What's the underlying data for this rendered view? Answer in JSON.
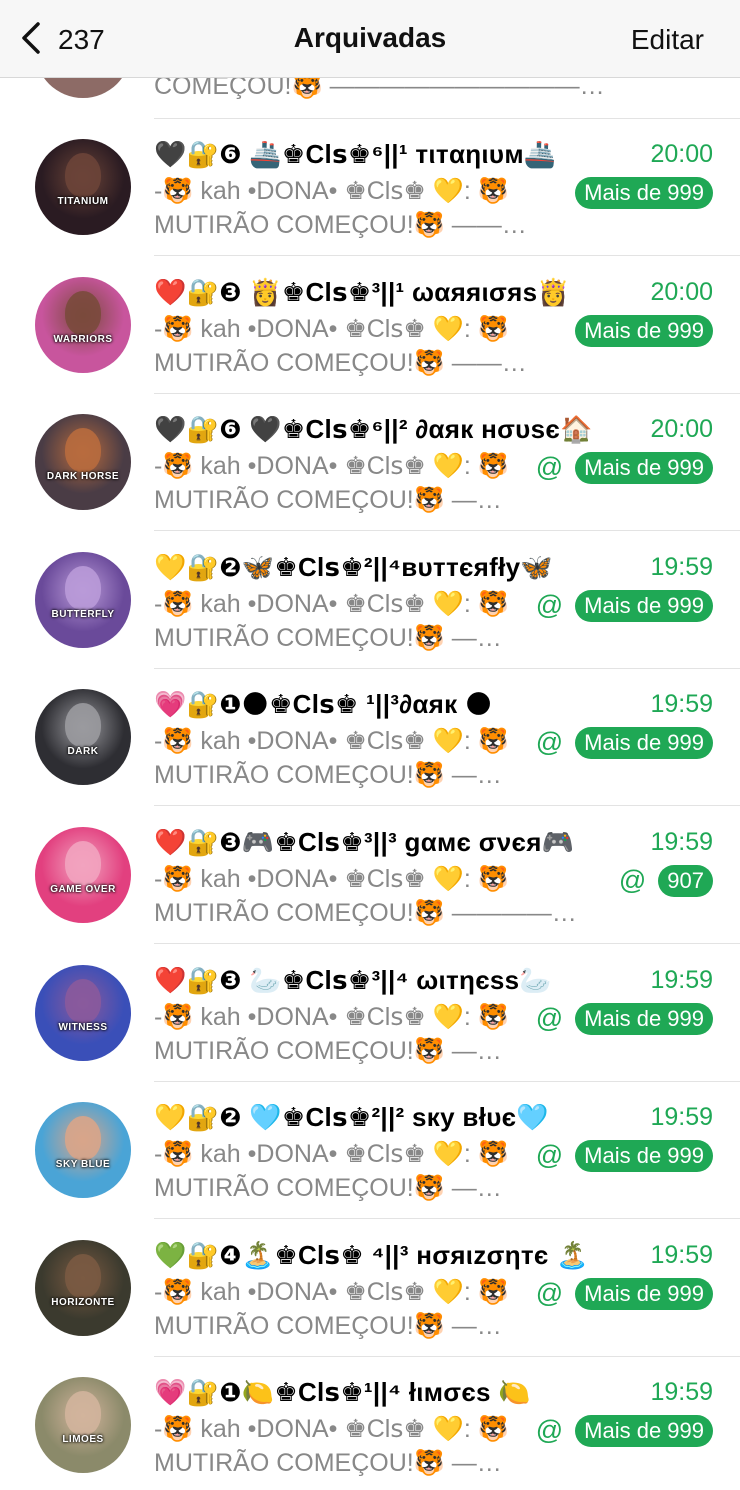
{
  "header": {
    "back_count": "237",
    "title": "Arquivadas",
    "edit_label": "Editar"
  },
  "partial_row": {
    "preview": "COMEÇOU!🐯 ——————————…"
  },
  "colors": {
    "accent_green": "#1fa855",
    "preview_gray": "#888888"
  },
  "chats": [
    {
      "name": "🖤🔐❻ 🚢♚Clꜱ♚⁶||¹ тιтαηιυм🚢",
      "time": "20:00",
      "sender": "-🐯 kah •DONA• ♚Clꜱ♚ 💛: 🐯",
      "preview": "MUTIRÃO  COMEÇOU!🐯 ——…",
      "mention": "",
      "badge": "Mais de 999",
      "avatar_label": "TITANIUM",
      "avatar_bg": "#2a1b22",
      "avatar_face": "#6b4438"
    },
    {
      "name": "❤️🔐❸ 👸♚Clꜱ♚³||¹  ωαяяισяѕ👸",
      "time": "20:00",
      "sender": "-🐯 kah •DONA• ♚Clꜱ♚ 💛: 🐯",
      "preview": "MUTIRÃO  COMEÇOU!🐯 ——…",
      "mention": "",
      "badge": "Mais de 999",
      "avatar_label": "WARRIORS",
      "avatar_bg": "#c8559d",
      "avatar_face": "#7a4a3c"
    },
    {
      "name": "🖤🔐❻ 🖤♚Clꜱ♚⁶||² ∂αяк нσυѕє🏠",
      "time": "20:00",
      "sender": "-🐯 kah •DONA• ♚Clꜱ♚ 💛: 🐯",
      "preview": "MUTIRÃO  COMEÇOU!🐯 —…",
      "mention": "@",
      "badge": "Mais de 999",
      "avatar_label": "DARK HORSE",
      "avatar_bg": "#4a3c45",
      "avatar_face": "#b86b3e"
    },
    {
      "name": "💛🔐❷🦋♚Clꜱ♚²||⁴вυттєяfłу🦋",
      "time": "19:59",
      "sender": "-🐯 kah •DONA• ♚Clꜱ♚ 💛: 🐯",
      "preview": "MUTIRÃO  COMEÇOU!🐯 —…",
      "mention": "@",
      "badge": "Mais de 999",
      "avatar_label": "BUTTERFLY",
      "avatar_bg": "#6a4a9a",
      "avatar_face": "#b99ad8"
    },
    {
      "name": "💗🔐❶🌑♚Clꜱ♚ ¹||³∂αяк 🌑",
      "time": "19:59",
      "sender": "-🐯 kah •DONA• ♚Clꜱ♚ 💛: 🐯",
      "preview": "MUTIRÃO  COMEÇOU!🐯 —…",
      "mention": "@",
      "badge": "Mais de 999",
      "avatar_label": "DARK",
      "avatar_bg": "#2e2e33",
      "avatar_face": "#9a9a9f"
    },
    {
      "name": "❤️🔐❸🎮♚Clꜱ♚³||³ gαмє σνєя🎮",
      "time": "19:59",
      "sender": "-🐯 kah •DONA• ♚Clꜱ♚ 💛: 🐯",
      "preview": "MUTIRÃO  COMEÇOU!🐯 ————…",
      "mention": "@",
      "badge": "907",
      "avatar_label": "GAME OVER",
      "avatar_bg": "#e2407f",
      "avatar_face": "#f2a3bf"
    },
    {
      "name": "❤️🔐❸ 🦢♚Clꜱ♚³||⁴ ωιтηєѕѕ🦢",
      "time": "19:59",
      "sender": "-🐯 kah •DONA• ♚Clꜱ♚ 💛: 🐯",
      "preview": "MUTIRÃO  COMEÇOU!🐯 —…",
      "mention": "@",
      "badge": "Mais de 999",
      "avatar_label": "WITNESS",
      "avatar_bg": "#3a4fb8",
      "avatar_face": "#8a5a9c"
    },
    {
      "name": "💛🔐❷ 🩵♚Clꜱ♚²||² ѕку вłυє🩵",
      "time": "19:59",
      "sender": "-🐯 kah •DONA• ♚Clꜱ♚ 💛: 🐯",
      "preview": "MUTIRÃO  COMEÇOU!🐯 —…",
      "mention": "@",
      "badge": "Mais de 999",
      "avatar_label": "SKY BLUE",
      "avatar_bg": "#4aa4d6",
      "avatar_face": "#d8a58a"
    },
    {
      "name": "💚🔐❹🏝️♚Clꜱ♚ ⁴||³ нσяιzσηтє 🏝️",
      "time": "19:59",
      "sender": "-🐯 kah •DONA• ♚Clꜱ♚ 💛: 🐯",
      "preview": "MUTIRÃO  COMEÇOU!🐯 —…",
      "mention": "@",
      "badge": "Mais de 999",
      "avatar_label": "HORIZONTE",
      "avatar_bg": "#3b3a2e",
      "avatar_face": "#7a5a42"
    },
    {
      "name": "💗🔐❶🍋♚Clꜱ♚¹||⁴ łιмσєѕ 🍋",
      "time": "19:59",
      "sender": "-🐯 kah •DONA• ♚Clꜱ♚ 💛: 🐯",
      "preview": "MUTIRÃO  COMEÇOU!🐯 —…",
      "mention": "@",
      "badge": "Mais de 999",
      "avatar_label": "LIMOES",
      "avatar_bg": "#8b8a6a",
      "avatar_face": "#d2b49c"
    }
  ]
}
